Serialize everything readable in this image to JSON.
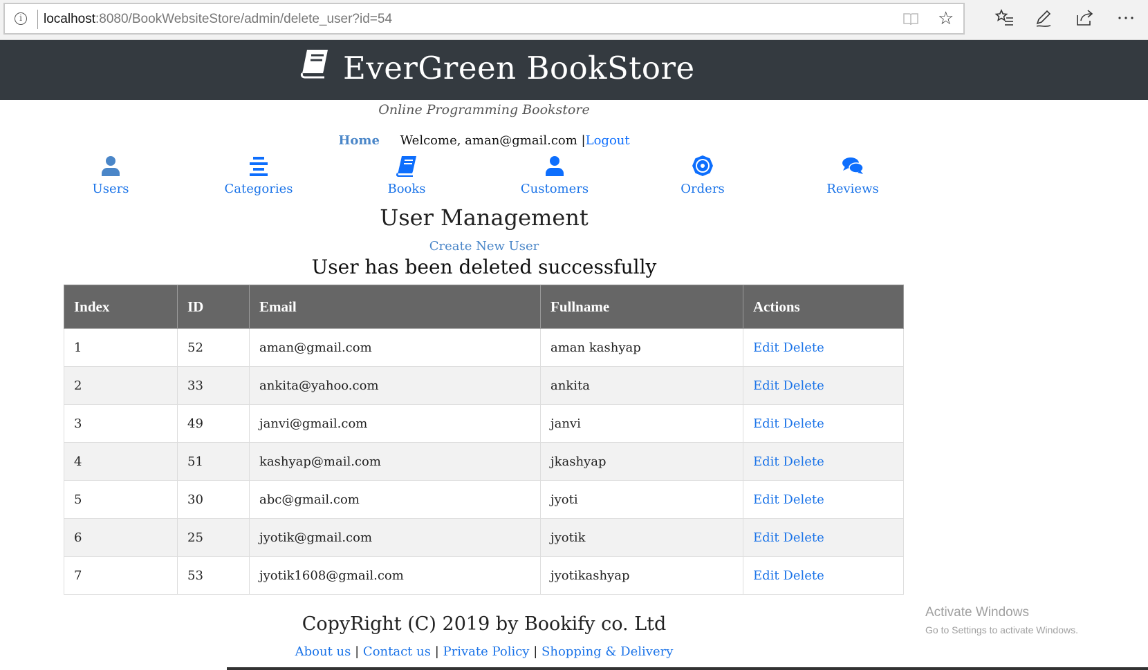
{
  "browser": {
    "url_host": "localhost",
    "url_rest": ":8080/BookWebsiteStore/admin/delete_user?id=54"
  },
  "header": {
    "title": "EverGreen BookStore",
    "tagline": "Online Programming Bookstore",
    "home_label": "Home",
    "welcome_text": "Welcome, aman@gmail.com |",
    "logout_label": "Logout"
  },
  "menu": [
    {
      "label": "Users",
      "icon": "user-icon"
    },
    {
      "label": "Categories",
      "icon": "categories-icon"
    },
    {
      "label": "Books",
      "icon": "book-icon"
    },
    {
      "label": "Customers",
      "icon": "customer-icon"
    },
    {
      "label": "Orders",
      "icon": "orders-icon"
    },
    {
      "label": "Reviews",
      "icon": "reviews-icon"
    }
  ],
  "main": {
    "title": "User Management",
    "create_link": "Create New User",
    "message": "User has been deleted successfully"
  },
  "table": {
    "headers": [
      "Index",
      "ID",
      "Email",
      "Fullname",
      "Actions"
    ],
    "edit_label": "Edit",
    "delete_label": "Delete",
    "rows": [
      {
        "index": "1",
        "id": "52",
        "email": "aman@gmail.com",
        "fullname": "aman kashyap"
      },
      {
        "index": "2",
        "id": "33",
        "email": "ankita@yahoo.com",
        "fullname": "ankita"
      },
      {
        "index": "3",
        "id": "49",
        "email": "janvi@gmail.com",
        "fullname": "janvi"
      },
      {
        "index": "4",
        "id": "51",
        "email": "kashyap@mail.com",
        "fullname": "jkashyap"
      },
      {
        "index": "5",
        "id": "30",
        "email": "abc@gmail.com",
        "fullname": "jyoti"
      },
      {
        "index": "6",
        "id": "25",
        "email": "jyotik@gmail.com",
        "fullname": "jyotik"
      },
      {
        "index": "7",
        "id": "53",
        "email": "jyotik1608@gmail.com",
        "fullname": "jyotikashyap"
      }
    ]
  },
  "footer": {
    "copyright": "CopyRight (C) 2019 by Bookify co. Ltd",
    "links": [
      "About us",
      "Contact us",
      "Private Policy",
      "Shopping & Delivery"
    ],
    "separator": "|"
  },
  "watermark": {
    "line1": "Activate Windows",
    "line2": "Go to Settings to activate Windows."
  },
  "colors": {
    "header_bg": "#343a40",
    "link": "#1a73e8",
    "table_header_bg": "#666666",
    "stripe": "#f2f2f2"
  }
}
